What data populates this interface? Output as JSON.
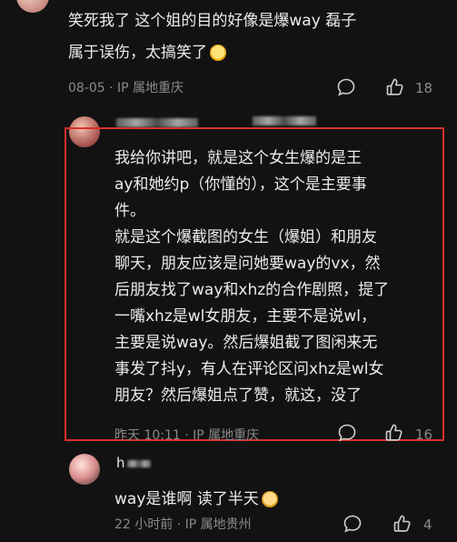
{
  "comments": [
    {
      "lines": [
        "笑死我了 这个姐的目的好像是爆way 磊子",
        "属于误伤，太搞笑了"
      ],
      "emoji": "laughing-crying-emoji",
      "meta": "08-05 · IP 属地重庆",
      "likes": "18"
    },
    {
      "lines": [
        "我给你讲吧，就是这个女生爆的是王",
        "ay和她约p（你懂的），这个是主要事",
        "件。",
        "就是这个爆截图的女生（爆姐）和朋友",
        "聊天，朋友应该是问她要way的vx，然",
        "后朋友找了way和xhz的合作剧照，提了",
        "一嘴xhz是wl女朋友，主要不是说wl，",
        "主要是说way。然后爆姐截了图闲来无",
        "事发了抖y，有人在评论区问xhz是wl女",
        "朋友？然后爆姐点了赞，就这，没了"
      ],
      "meta": "昨天 10:11 · IP 属地重庆",
      "likes": "16"
    },
    {
      "username": "h",
      "lines": [
        "way是谁啊 读了半天"
      ],
      "emoji": "cat-laughing-emoji",
      "meta": "22 小时前 · IP 属地贵州",
      "likes": "4"
    }
  ],
  "colors": {
    "highlight_border": "#d7302b",
    "background": "#121212",
    "meta_text": "#8a8a8a"
  }
}
